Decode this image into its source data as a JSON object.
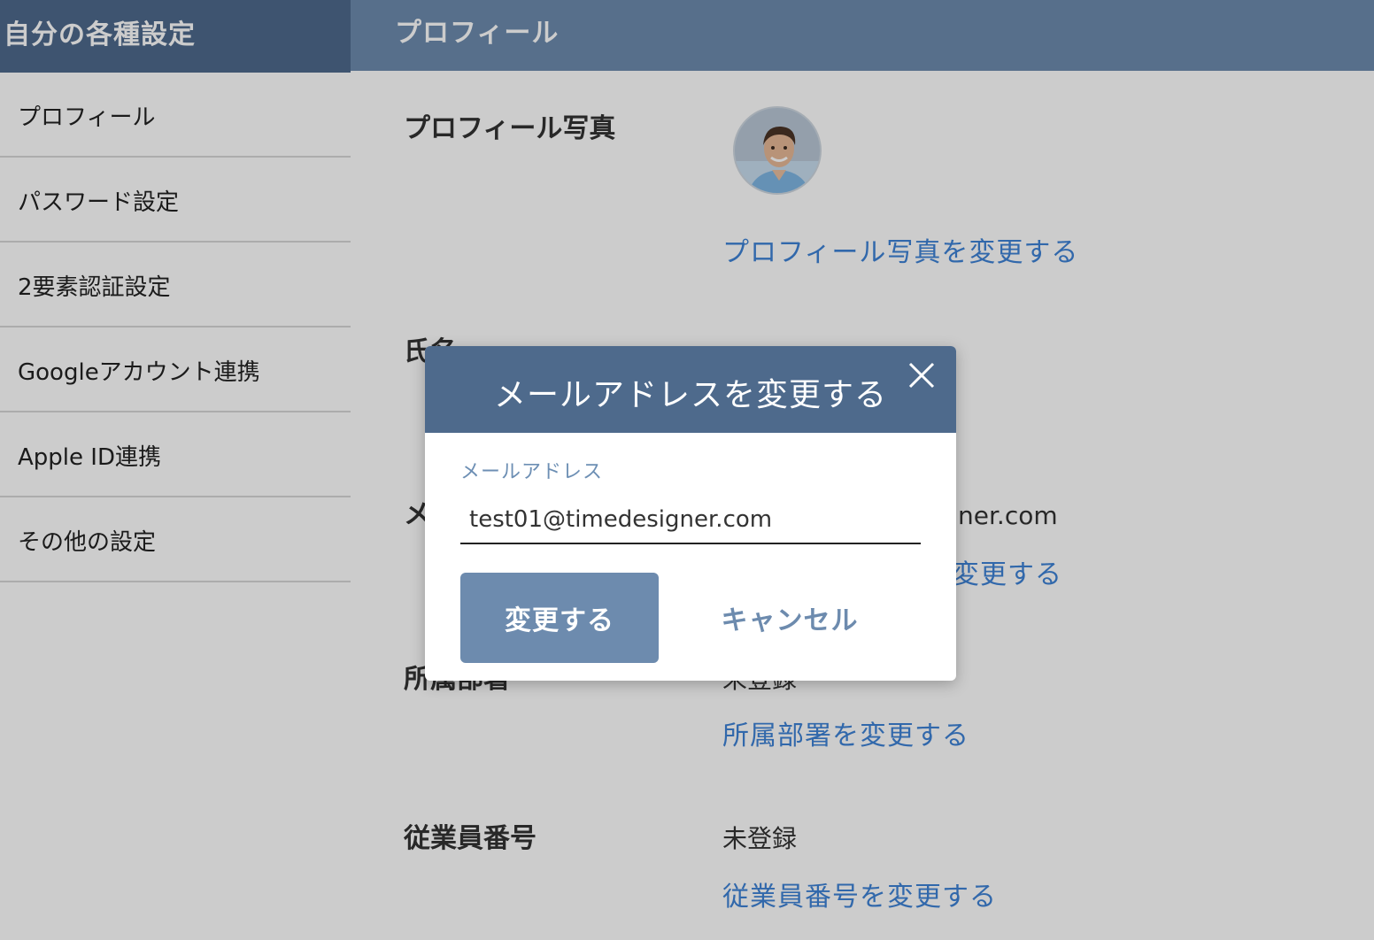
{
  "sidebar": {
    "title": "自分の各種設定",
    "items": [
      {
        "label": "プロフィール"
      },
      {
        "label": "パスワード設定"
      },
      {
        "label": "2要素認証設定"
      },
      {
        "label": "Googleアカウント連携"
      },
      {
        "label": "Apple ID連携"
      },
      {
        "label": "その他の設定"
      }
    ]
  },
  "main": {
    "title": "プロフィール",
    "photo": {
      "label": "プロフィール写真",
      "link": "プロフィール写真を変更する"
    },
    "name": {
      "label": "氏名"
    },
    "email": {
      "label": "メ",
      "value_partial": "ner.com",
      "link_partial": "変更する"
    },
    "department": {
      "label": "所属部署",
      "value": "未登録",
      "link": "所属部署を変更する"
    },
    "employee_number": {
      "label": "従業員番号",
      "value": "未登録",
      "link": "従業員番号を変更する"
    }
  },
  "dialog": {
    "title": "メールアドレスを変更する",
    "field_label": "メールアドレス",
    "email_value": "test01@timedesigner.com",
    "submit_label": "変更する",
    "cancel_label": "キャンセル"
  },
  "colors": {
    "header_dark": "#4e6a8c",
    "header_light": "#6d8bae",
    "link": "#3e82d6",
    "button": "#6d8bae"
  }
}
